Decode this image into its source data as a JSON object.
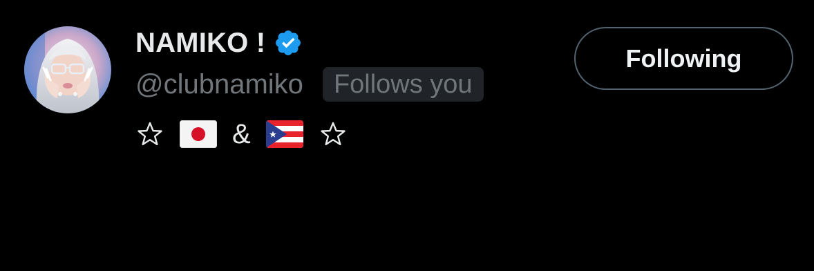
{
  "profile": {
    "display_name": "NAMIKO !",
    "handle": "@clubnamiko",
    "follows_you_label": "Follows you",
    "verified": true,
    "bio": {
      "star_left": "☆",
      "amp": "&",
      "star_right": "☆",
      "flag_1": "flag-japan",
      "flag_2": "flag-puerto-rico"
    }
  },
  "actions": {
    "follow_button_label": "Following"
  },
  "colors": {
    "background": "#000000",
    "text_primary": "#e7e9ea",
    "text_secondary": "#71767b",
    "badge_bg": "#202327",
    "verified_blue": "#1d9bf0",
    "button_border": "#536471"
  },
  "icons": {
    "verified": "verified-badge-icon",
    "avatar": "avatar-image"
  }
}
